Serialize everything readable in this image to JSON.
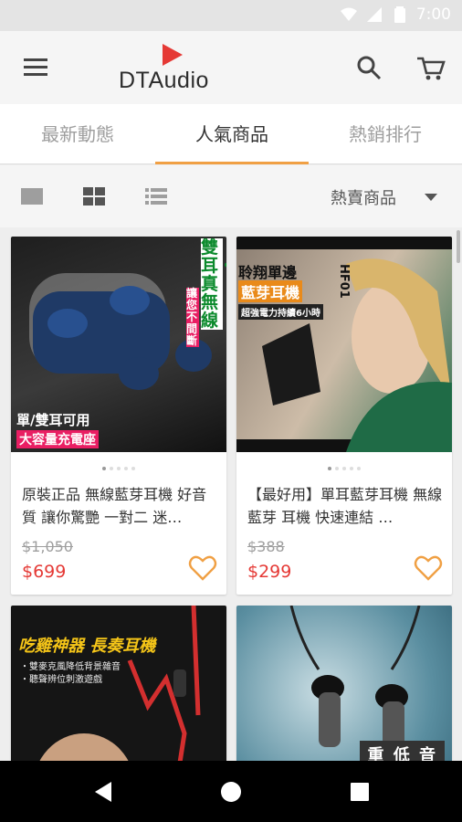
{
  "status_bar": {
    "time": "7:00",
    "icons": [
      "wifi-icon",
      "signal-icon",
      "battery-icon"
    ]
  },
  "app_bar": {
    "brand": "DTAudio",
    "menu_icon": "menu-icon",
    "search_icon": "search-icon",
    "cart_icon": "cart-icon",
    "brand_color": "#e53935"
  },
  "tabs": [
    {
      "label": "最新動態"
    },
    {
      "label": "人氣商品",
      "active": true
    },
    {
      "label": "熱銷排行"
    }
  ],
  "toolbar": {
    "sort_label": "熱賣商品",
    "views": [
      "single-view-icon",
      "grid-view-icon",
      "list-view-icon"
    ]
  },
  "products": [
    {
      "title": "原裝正品 無線藍芽耳機 好音質 讓你驚艷 一對二 迷…",
      "original_price": "$1,050",
      "price": "$699",
      "image_text": {
        "vertical": "雙耳・真無線",
        "side": "讓您不間斷",
        "bottom1": "單/雙耳可用",
        "bottom2": "大容量充電座"
      }
    },
    {
      "title": "【最好用】單耳藍芽耳機 無線 藍芽 耳機 快速連結 …",
      "original_price": "$388",
      "price": "$299",
      "image_text": {
        "line1": "聆翔單邊",
        "line2": "藍芽耳機",
        "model": "HF01",
        "sub": "超強電力持續6小時"
      }
    },
    {
      "title": "",
      "original_price": "",
      "price": "",
      "image_text": {
        "headline": "吃雞神器 長奏耳機",
        "bullet1": "・雙麥克風降低背景雜音",
        "bullet2": "・聽聲辨位刺激遊戲"
      }
    },
    {
      "title": "",
      "original_price": "",
      "price": "",
      "image_text": {
        "caption": "重 低 音"
      }
    }
  ],
  "colors": {
    "accent": "#f0a044",
    "price": "#e53935",
    "heart": "#f0a044"
  }
}
